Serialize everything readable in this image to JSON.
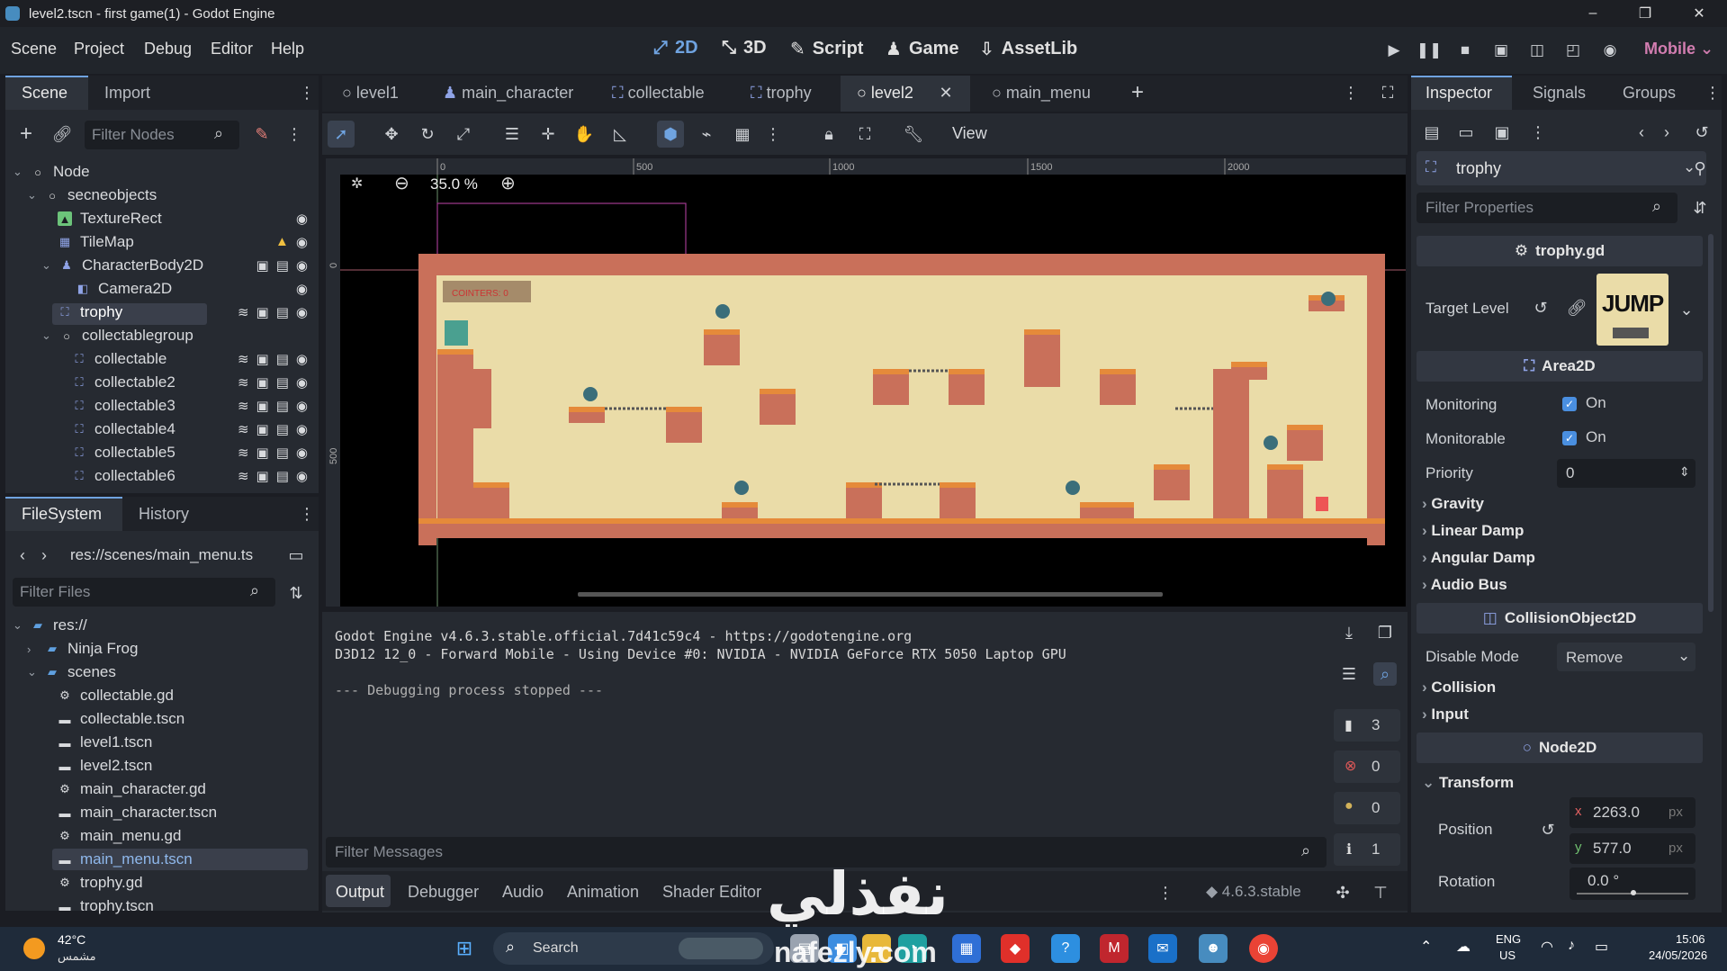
{
  "window": {
    "title": "level2.tscn - first game(1) - Godot Engine",
    "controls": [
      "–",
      "❐",
      "✕"
    ]
  },
  "menu": {
    "items": [
      "Scene",
      "Project",
      "Debug",
      "Editor",
      "Help"
    ]
  },
  "workspaces": {
    "two_d": "2D",
    "three_d": "3D",
    "script": "Script",
    "game": "Game",
    "assetlib": "AssetLib"
  },
  "renderer": "Mobile",
  "scene_dock": {
    "tabs": [
      "Scene",
      "Import"
    ],
    "filter_placeholder": "Filter Nodes",
    "nodes": [
      {
        "label": "Node"
      },
      {
        "label": "secneobjects"
      },
      {
        "label": "TextureRect"
      },
      {
        "label": "TileMap"
      },
      {
        "label": "CharacterBody2D"
      },
      {
        "label": "Camera2D"
      },
      {
        "label": "trophy"
      },
      {
        "label": "collectablegroup"
      },
      {
        "label": "collectable"
      },
      {
        "label": "collectable2"
      },
      {
        "label": "collectable3"
      },
      {
        "label": "collectable4"
      },
      {
        "label": "collectable5"
      },
      {
        "label": "collectable6"
      }
    ]
  },
  "filesystem": {
    "tabs": [
      "FileSystem",
      "History"
    ],
    "path": "res://scenes/main_menu.ts",
    "filter_placeholder": "Filter Files",
    "items": [
      {
        "label": "res://"
      },
      {
        "label": "Ninja Frog"
      },
      {
        "label": "scenes"
      },
      {
        "label": "collectable.gd"
      },
      {
        "label": "collectable.tscn"
      },
      {
        "label": "level1.tscn"
      },
      {
        "label": "level2.tscn"
      },
      {
        "label": "main_character.gd"
      },
      {
        "label": "main_character.tscn"
      },
      {
        "label": "main_menu.gd"
      },
      {
        "label": "main_menu.tscn"
      },
      {
        "label": "trophy.gd"
      },
      {
        "label": "trophy.tscn"
      }
    ]
  },
  "scene_tabs": [
    "level1",
    "main_character",
    "collectable",
    "trophy",
    "level2",
    "main_menu"
  ],
  "viewport": {
    "view_label": "View",
    "zoom": "35.0 %",
    "ruler_top": [
      "0",
      "500",
      "1000",
      "1500",
      "2000"
    ],
    "ruler_left": [
      "0",
      "500"
    ],
    "hud_text": "COINTERS: 0"
  },
  "console": {
    "lines": [
      "Godot Engine v4.6.3.stable.official.7d41c59c4 - https://godotengine.org",
      "D3D12 12_0 - Forward Mobile - Using Device #0: NVIDIA - NVIDIA GeForce RTX 5050 Laptop GPU",
      "",
      "--- Debugging process stopped ---"
    ],
    "filter_placeholder": "Filter Messages",
    "counts": {
      "errors_total": "3",
      "errors": "0",
      "warnings": "0",
      "messages": "1"
    }
  },
  "bottom_tabs": [
    "Output",
    "Debugger",
    "Audio",
    "Animation",
    "Shader Editor"
  ],
  "version": "4.6.3.stable",
  "inspector": {
    "tabs": [
      "Inspector",
      "Signals",
      "Groups"
    ],
    "object": "trophy",
    "filter_placeholder": "Filter Properties",
    "script": "trophy.gd",
    "target_level_label": "Target Level",
    "area2d": "Area2D",
    "monitoring_label": "Monitoring",
    "monitoring_value": "On",
    "monitorable_label": "Monitorable",
    "monitorable_value": "On",
    "priority_label": "Priority",
    "priority_value": "0",
    "groups_area": [
      "Gravity",
      "Linear Damp",
      "Angular Damp",
      "Audio Bus"
    ],
    "collision_object": "CollisionObject2D",
    "disable_mode_label": "Disable Mode",
    "disable_mode_value": "Remove",
    "groups_collision": [
      "Collision",
      "Input"
    ],
    "node2d": "Node2D",
    "transform": "Transform",
    "position_label": "Position",
    "position_x": "2263.0",
    "position_y": "577.0",
    "unit": "px",
    "rotation_label": "Rotation",
    "rotation_value": "0.0 °",
    "thumb_text": "JUMP"
  },
  "taskbar": {
    "weather_temp": "42°C",
    "weather_desc": "مشمس",
    "search": "Search",
    "lang_top": "ENG",
    "lang_bottom": "US",
    "time": "15:06",
    "date": "24/05/2026"
  },
  "watermark": {
    "arabic": "نفذلي",
    "latin": "nafezly.com"
  },
  "colors": {
    "accent": "#478cbf",
    "active_blue": "#6fa3e0",
    "brick": "#c86a52",
    "sand": "#eadca8"
  }
}
